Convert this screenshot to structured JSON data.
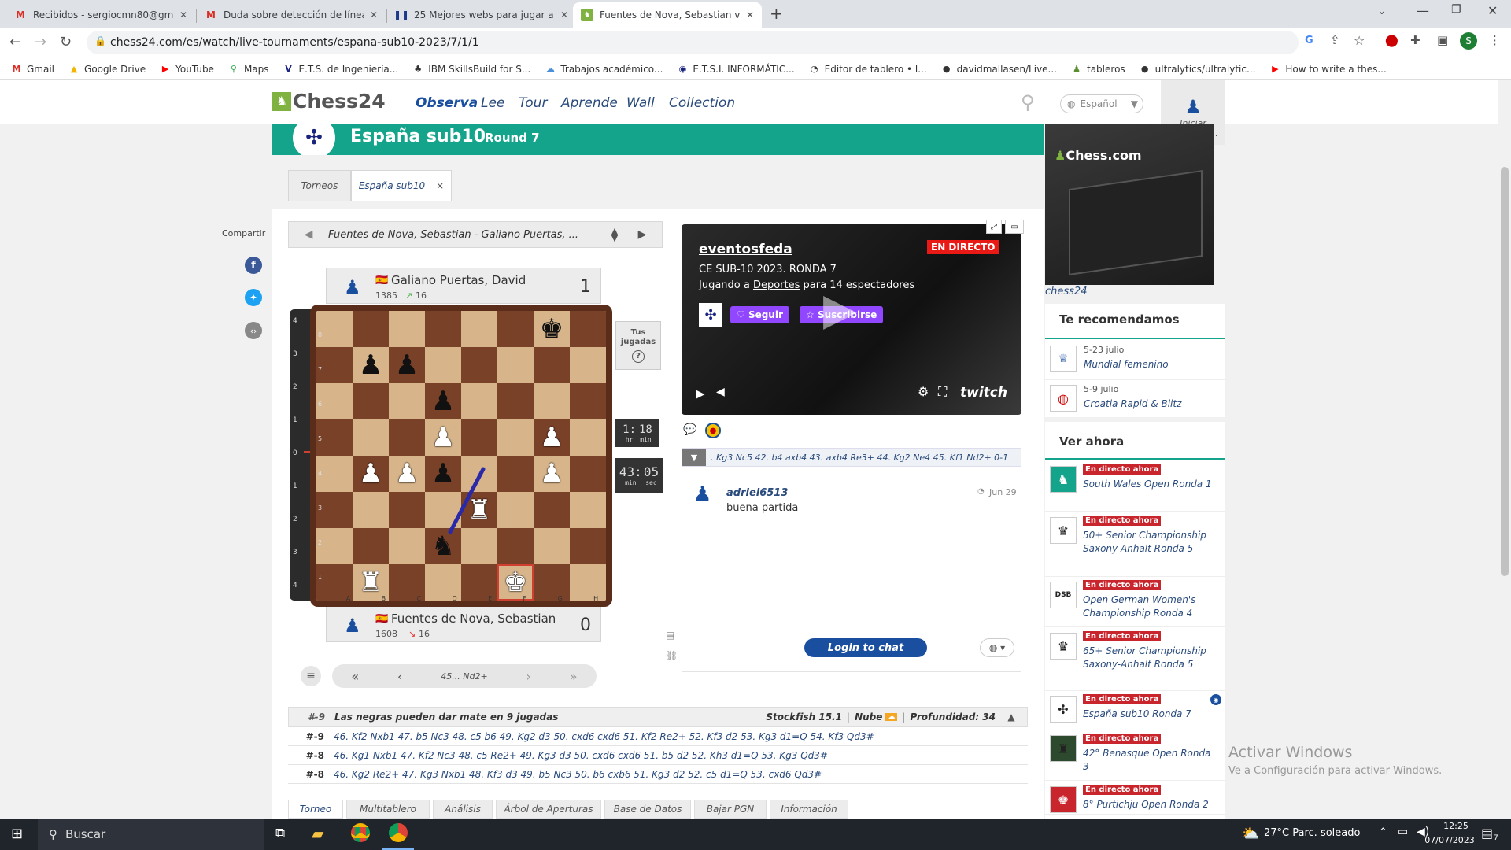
{
  "browser": {
    "tabs": [
      {
        "label": "Recibidos - sergiocmn80@gmail.",
        "icon": "gmail-icon"
      },
      {
        "label": "Duda sobre detección de líneas",
        "icon": "gmail-icon"
      },
      {
        "label": "25 Mejores webs para jugar al aj",
        "icon": "site-icon"
      },
      {
        "label": "Fuentes de Nova, Sebastian vs. G",
        "icon": "chess24-icon"
      }
    ],
    "url": "chess24.com/es/watch/live-tournaments/espana-sub10-2023/7/1/1",
    "bookmarks": [
      "Gmail",
      "Google Drive",
      "YouTube",
      "Maps",
      "E.T.S. de Ingeniería...",
      "IBM SkillsBuild for S...",
      "Trabajos académico...",
      "E.T.S.I. INFORMÁTIC...",
      "Editor de tablero • l...",
      "davidmallasen/Live...",
      "tableros",
      "ultralytics/ultralytic...",
      "How to write a thes..."
    ],
    "profile_initial": "S"
  },
  "site": {
    "logo": "Chess24",
    "nav": [
      "Observa",
      "Lee",
      "Tour",
      "Aprende",
      "Wall",
      "Collection"
    ],
    "language": "Español",
    "login": "Iniciar sesión/Re..."
  },
  "tournament": {
    "name": "España sub10",
    "round": "Round 7",
    "tabs": [
      "Torneos",
      "España sub10"
    ],
    "close_glyph": "×"
  },
  "share_label": "Compartir",
  "game_selector": "Fuentes de Nova, Sebastian - Galiano Puertas, ...",
  "top_player": {
    "name": "Galiano Puertas, David",
    "rating": "1385",
    "delta": "16",
    "score": "1"
  },
  "bottom_player": {
    "name": "Fuentes de Nova, Sebastian",
    "rating": "1608",
    "delta": "16",
    "score": "0"
  },
  "tus_jugadas": "Tus jugadas",
  "clock_top": {
    "h": "1:",
    "m": "18",
    "hl": "hr",
    "ml": "min"
  },
  "clock_bottom": {
    "m": "43:",
    "s": "05",
    "ml": "min",
    "sl": "sec"
  },
  "board": {
    "files": [
      "A",
      "B",
      "C",
      "D",
      "E",
      "F",
      "G",
      "H"
    ],
    "ranks": [
      "8",
      "7",
      "6",
      "5",
      "4",
      "3",
      "2",
      "1"
    ],
    "position": [
      [
        "",
        "",
        "",
        "",
        "",
        "",
        "k",
        ""
      ],
      [
        "",
        "p",
        "p",
        "",
        "",
        "",
        "",
        ""
      ],
      [
        "",
        "",
        "",
        "p",
        "",
        "",
        "",
        ""
      ],
      [
        "",
        "",
        "",
        "P",
        "",
        "",
        "P",
        ""
      ],
      [
        "",
        "P",
        "P",
        "p",
        "",
        "",
        "P",
        ""
      ],
      [
        "",
        "",
        "",
        "",
        "R",
        "",
        "",
        ""
      ],
      [
        "",
        "",
        "",
        "n",
        "",
        "",
        "",
        ""
      ],
      [
        "",
        "R",
        "",
        "",
        "",
        "K",
        "",
        ""
      ]
    ],
    "eval_marks": [
      "4",
      "3",
      "2",
      "1",
      "0",
      "1",
      "2",
      "3",
      "4"
    ]
  },
  "move_nav": {
    "current": "45... Nd2+"
  },
  "stream": {
    "channel": "eventosfeda",
    "live": "EN DIRECTO",
    "title": "CE SUB-10 2023. RONDA 7",
    "subtitle_pre": "Jugando a ",
    "subtitle_link": "Deportes",
    "subtitle_post": " para 14 espectadores",
    "follow": "Seguir",
    "subscribe": "Suscribirse",
    "brand": "twitch"
  },
  "movestrip": ". Kg3 Nc5 42. b4 axb4 43. axb4 Re3+ 44. Kg2 Ne4 45. Kf1 Nd2+ 0-1",
  "chat": {
    "user": "adriel6513",
    "date": "Jun 29",
    "message": "buena partida",
    "login_button": "Login to chat"
  },
  "engine": {
    "header_score": "#-9",
    "header_text": "Las negras pueden dar mate en 9 jugadas",
    "engine_name": "Stockfish 15.1",
    "cloud": "Nube",
    "depth": "Profundidad: 34",
    "lines": [
      {
        "score": "#-9",
        "moves": "46. Kf2 Nxb1 47. b5 Nc3 48. c5 b6 49. Kg2 d3 50. cxd6 cxd6 51. Kf2 Re2+ 52. Kf3 d2 53. Kg3 d1=Q 54. Kf3 Qd3#"
      },
      {
        "score": "#-8",
        "moves": "46. Kg1 Nxb1 47. Kf2 Nc3 48. c5 Re2+ 49. Kg3 d3 50. cxd6 cxd6 51. b5 d2 52. Kh3 d1=Q 53. Kg3 Qd3#"
      },
      {
        "score": "#-8",
        "moves": "46. Kg2 Re2+ 47. Kg3 Nxb1 48. Kf3 d3 49. b5 Nc3 50. b6 cxb6 51. Kg3 d2 52. c5 d1=Q 53. cxd6 Qd3#"
      }
    ]
  },
  "bottom_tabs": [
    "Torneo",
    "Multitablero",
    "Análisis",
    "Árbol de Aperturas",
    "Base de Datos",
    "Bajar PGN",
    "Información"
  ],
  "ad": {
    "brand": "Chess.com",
    "alt": "chess24"
  },
  "recommend": {
    "title": "Te recomendamos",
    "items": [
      {
        "date": "5-23 julio",
        "name": "Mundial femenino"
      },
      {
        "date": "5-9 julio",
        "name": "Croatia Rapid & Blitz"
      }
    ]
  },
  "watch_now": {
    "title": "Ver ahora",
    "badge": "En directo ahora",
    "items": [
      "South Wales Open Ronda 1",
      "50+ Senior Championship Saxony-Anhalt Ronda 5",
      "Open German Women's Championship Ronda 4",
      "65+ Senior Championship Saxony-Anhalt Ronda 5",
      "España sub10 Ronda 7",
      "42° Benasque Open Ronda 3",
      "8° Purtichju Open Ronda 2"
    ],
    "dsb": "DSB"
  },
  "watermark": {
    "title": "Activar Windows",
    "sub": "Ve a Configuración para activar Windows."
  },
  "taskbar": {
    "search": "Buscar",
    "weather": "27°C  Parc. soleado",
    "time": "12:25",
    "date": "07/07/2023",
    "notif": "7"
  }
}
